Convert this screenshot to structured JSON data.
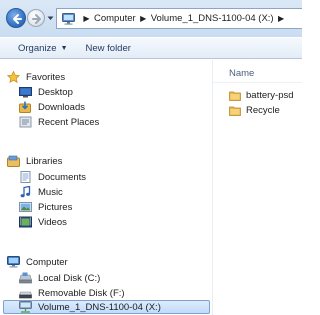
{
  "address_bar": {
    "breadcrumbs": [
      "Computer",
      "Volume_1_DNS-1100-04 (X:)"
    ],
    "icon": "computer-icon"
  },
  "toolbar": {
    "organize_label": "Organize",
    "new_folder_label": "New folder"
  },
  "nav_pane": {
    "favorites": {
      "label": "Favorites",
      "items": [
        {
          "label": "Desktop",
          "icon": "desktop-icon"
        },
        {
          "label": "Downloads",
          "icon": "downloads-icon"
        },
        {
          "label": "Recent Places",
          "icon": "recent-places-icon"
        }
      ]
    },
    "libraries": {
      "label": "Libraries",
      "items": [
        {
          "label": "Documents",
          "icon": "documents-icon"
        },
        {
          "label": "Music",
          "icon": "music-icon"
        },
        {
          "label": "Pictures",
          "icon": "pictures-icon"
        },
        {
          "label": "Videos",
          "icon": "videos-icon"
        }
      ]
    },
    "computer": {
      "label": "Computer",
      "items": [
        {
          "label": "Local Disk (C:)",
          "icon": "local-disk-icon"
        },
        {
          "label": "Removable Disk (F:)",
          "icon": "removable-disk-icon"
        },
        {
          "label": "Volume_1_DNS-1100-04 (X:)",
          "icon": "network-drive-icon",
          "selected": true
        }
      ]
    }
  },
  "content": {
    "column_header": "Name",
    "files": [
      {
        "name": "battery-psd",
        "icon": "folder-icon"
      },
      {
        "name": "Recycle",
        "icon": "folder-icon"
      }
    ]
  },
  "colors": {
    "selection_bg": "#c1dbfc",
    "selection_border": "#7da2ce",
    "folder": "#e8b94a",
    "header_text": "#4c607a"
  }
}
